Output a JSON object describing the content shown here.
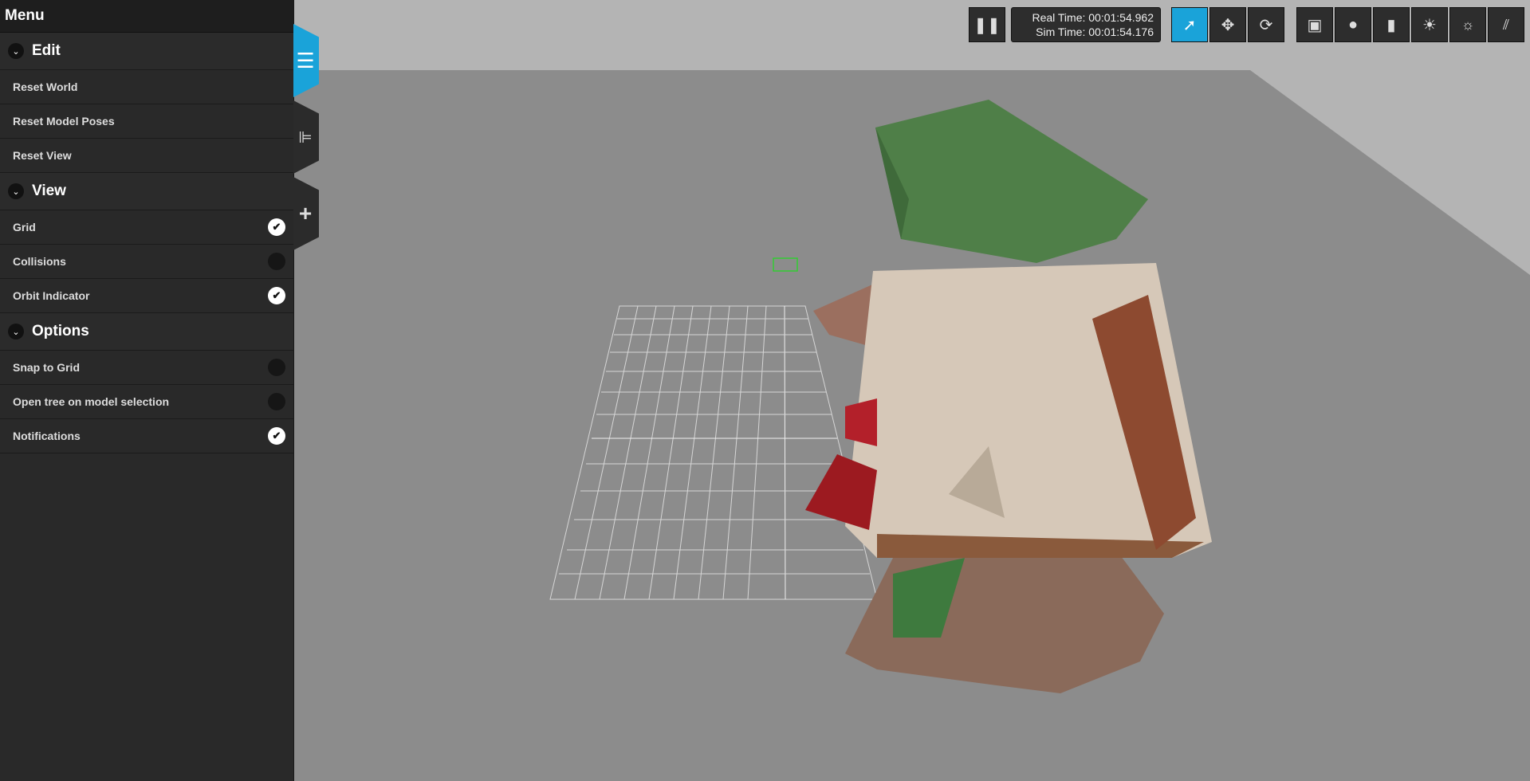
{
  "menu": {
    "title": "Menu",
    "sections": [
      {
        "label": "Edit",
        "items": [
          {
            "label": "Reset World"
          },
          {
            "label": "Reset Model Poses"
          },
          {
            "label": "Reset View"
          }
        ]
      },
      {
        "label": "View",
        "items": [
          {
            "label": "Grid",
            "checked": true
          },
          {
            "label": "Collisions",
            "checked": false
          },
          {
            "label": "Orbit Indicator",
            "checked": true
          }
        ]
      },
      {
        "label": "Options",
        "items": [
          {
            "label": "Snap to Grid",
            "checked": false
          },
          {
            "label": "Open tree on model selection",
            "checked": false
          },
          {
            "label": "Notifications",
            "checked": true
          }
        ]
      }
    ]
  },
  "side_tabs": [
    "menu-icon",
    "model-tree-icon",
    "insert-icon"
  ],
  "time": {
    "real": "Real Time: 00:01:54.962",
    "sim": "Sim Time: 00:01:54.176"
  },
  "toolbar": {
    "pause_icon": "pause-icon",
    "modes": [
      "select-icon",
      "translate-icon",
      "rotate-icon"
    ],
    "active_mode": "select-icon",
    "shapes": [
      "box-icon",
      "sphere-icon",
      "cylinder-icon",
      "point-light-icon",
      "spot-light-icon",
      "directional-light-icon"
    ]
  },
  "colors": {
    "accent": "#1aa3d9",
    "panel": "#262626"
  }
}
